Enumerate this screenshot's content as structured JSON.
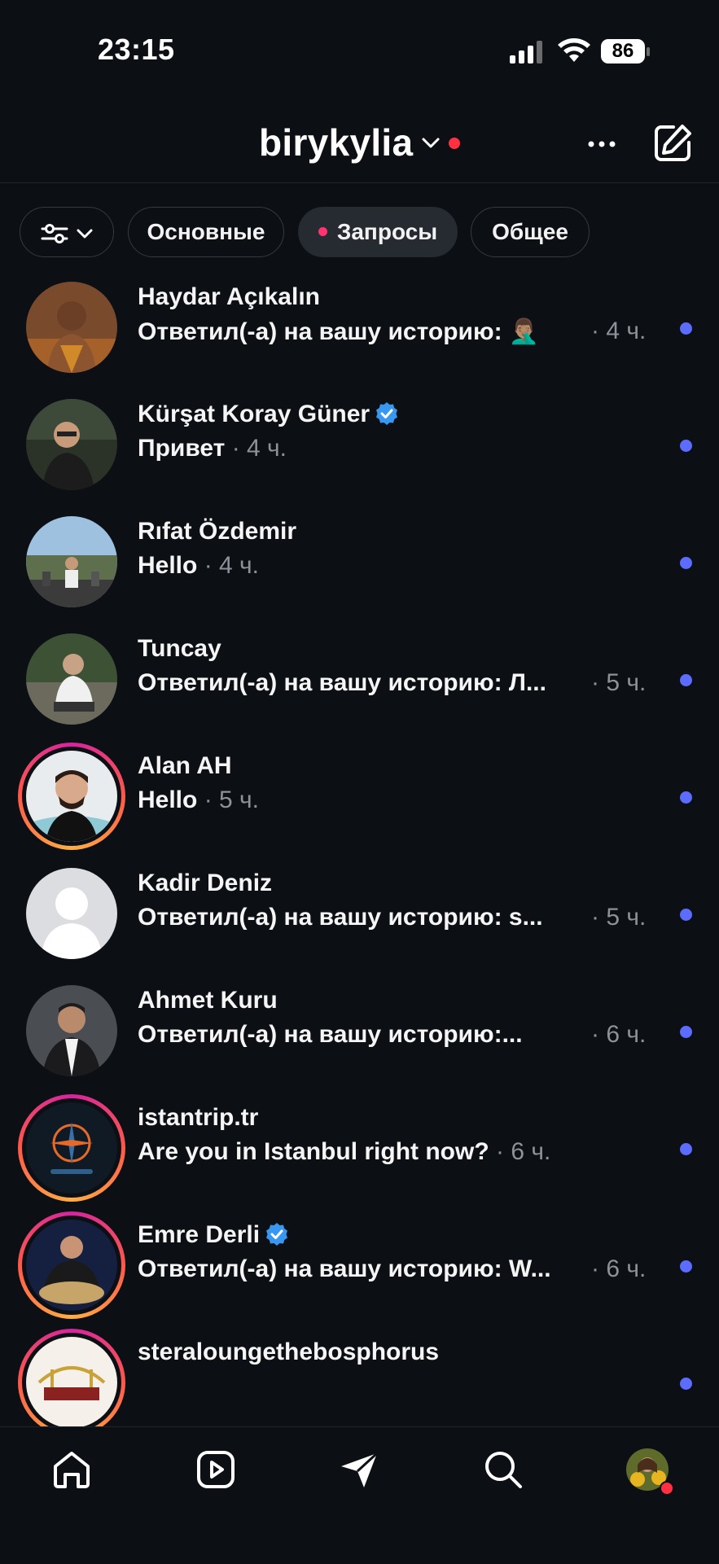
{
  "status_bar": {
    "time": "23:15",
    "battery": "86"
  },
  "header": {
    "account": "birykylia"
  },
  "filters": [
    {
      "label": "Основные"
    },
    {
      "label": "Запросы"
    },
    {
      "label": "Общее"
    }
  ],
  "threads": [
    {
      "name": "Haydar Açıkalın",
      "preview": "Ответил(-а) на вашу историю: 🤦🏽‍♂️",
      "time": "· 4 ч."
    },
    {
      "name": "Kürşat Koray Güner",
      "preview": "Привет",
      "time": "· 4 ч."
    },
    {
      "name": "Rıfat Özdemir",
      "preview": "Hello",
      "time": "· 4 ч."
    },
    {
      "name": "Tuncay",
      "preview": "Ответил(-а) на вашу историю: Л...",
      "time": "· 5 ч."
    },
    {
      "name": "Alan AH",
      "preview": "Hello",
      "time": "· 5 ч."
    },
    {
      "name": "Kadir Deniz",
      "preview": "Ответил(-а) на вашу историю: s...",
      "time": "· 5 ч."
    },
    {
      "name": "Ahmet Kuru",
      "preview": "Ответил(-а) на вашу историю:...",
      "time": "· 6 ч."
    },
    {
      "name": "istantrip.tr",
      "preview": "Are you in Istanbul right now?",
      "time": "· 6 ч."
    },
    {
      "name": "Emre Derli",
      "preview": "Ответил(-а) на вашу историю: W...",
      "time": "· 6 ч."
    },
    {
      "name": "steraloungethebosphorus",
      "preview": "",
      "time": ""
    }
  ],
  "colors": {
    "background": "#0c0f14",
    "unread": "#5b6cff",
    "accent_dot": "#ff3040",
    "verified": "#3897f0"
  }
}
